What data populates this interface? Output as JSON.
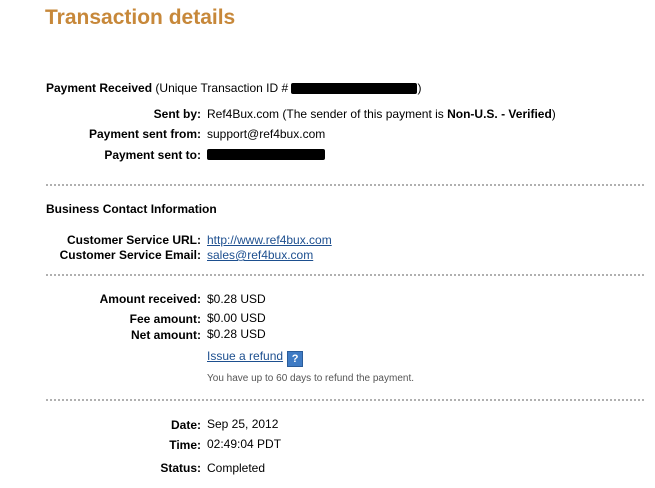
{
  "title": "Transaction details",
  "payment": {
    "heading_bold": "Payment Received",
    "heading_rest": "(Unique Transaction ID #",
    "heading_close": ")",
    "sent_by_label": "Sent by:",
    "sent_by_value": "Ref4Bux.com (The sender of this payment is ",
    "sent_by_status": "Non-U.S. - Verified",
    "sent_by_close": ")",
    "sent_from_label": "Payment sent from:",
    "sent_from_value": "support@ref4bux.com",
    "sent_to_label": "Payment sent to:"
  },
  "business": {
    "heading": "Business Contact Information",
    "url_label": "Customer Service URL:",
    "url_value": "http://www.ref4bux.com",
    "email_label": "Customer Service Email:",
    "email_value": "sales@ref4bux.com"
  },
  "amounts": {
    "received_label": "Amount received:",
    "received_value": "$0.28 USD",
    "fee_label": "Fee amount:",
    "fee_value": "$0.00 USD",
    "net_label": "Net amount:",
    "net_value": "$0.28 USD",
    "refund_link": "Issue a refund",
    "help_glyph": "?",
    "refund_note": "You have up to 60 days to refund the payment."
  },
  "status": {
    "date_label": "Date:",
    "date_value": "Sep 25, 2012",
    "time_label": "Time:",
    "time_value": "02:49:04 PDT",
    "status_label": "Status:",
    "status_value": "Completed"
  },
  "colors": {
    "title": "#c7883a",
    "link": "#1d4f8f",
    "divider": "#b0b0b0",
    "help_icon": "#3f7bc4"
  }
}
